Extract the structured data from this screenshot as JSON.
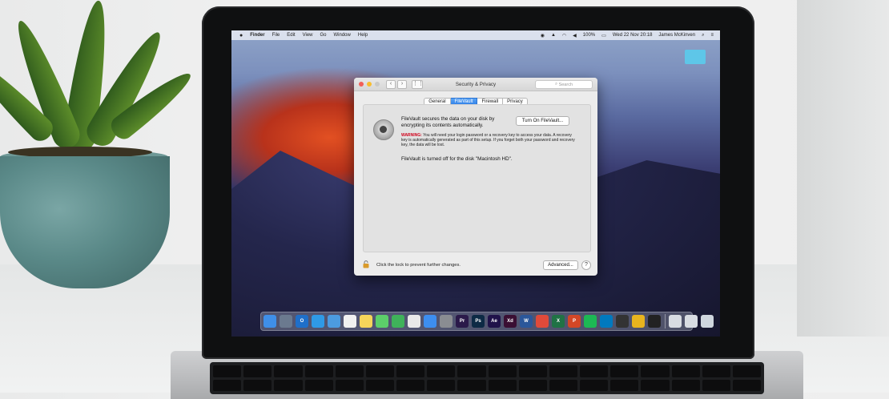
{
  "menubar": {
    "apple": "",
    "items": [
      "Finder",
      "File",
      "Edit",
      "View",
      "Go",
      "Window",
      "Help"
    ],
    "battery": "100%",
    "datetime": "Wed 22 Nov  20:18",
    "user": "James McKinven"
  },
  "window": {
    "title": "Security & Privacy",
    "search_placeholder": "Search",
    "back_glyph": "‹",
    "forward_glyph": "›",
    "tabs": [
      {
        "label": "General",
        "active": false
      },
      {
        "label": "FileVault",
        "active": true
      },
      {
        "label": "Firewall",
        "active": false
      },
      {
        "label": "Privacy",
        "active": false
      }
    ],
    "filevault": {
      "description": "FileVault secures the data on your disk by encrypting its contents automatically.",
      "turn_on_label": "Turn On FileVault...",
      "warning_label": "WARNING:",
      "warning_text": " You will need your login password or a recovery key to access your data. A recovery key is automatically generated as part of this setup. If you forget both your password and recovery key, the data will be lost.",
      "status": "FileVault is turned off for the disk \"Macintosh HD\"."
    },
    "lock_text": "Click the lock to prevent further changes.",
    "advanced_label": "Advanced...",
    "help_label": "?"
  },
  "dock": {
    "apps": [
      {
        "name": "finder-icon",
        "label": "",
        "color": "#3f8fe8"
      },
      {
        "name": "launchpad-icon",
        "label": "",
        "color": "#6b7a8f"
      },
      {
        "name": "outlook-icon",
        "label": "O",
        "color": "#1f6fc9"
      },
      {
        "name": "safari-icon",
        "label": "",
        "color": "#2f9ae6"
      },
      {
        "name": "mail-icon",
        "label": "",
        "color": "#4c9be0"
      },
      {
        "name": "calendar-icon",
        "label": "",
        "color": "#f1f1f1"
      },
      {
        "name": "notes-icon",
        "label": "",
        "color": "#f5d55a"
      },
      {
        "name": "messages-icon",
        "label": "",
        "color": "#5ccf6a"
      },
      {
        "name": "facetime-icon",
        "label": "",
        "color": "#3fb25a"
      },
      {
        "name": "photos-icon",
        "label": "",
        "color": "#e9e9e9"
      },
      {
        "name": "app-store-icon",
        "label": "",
        "color": "#3d8ef0"
      },
      {
        "name": "system-preferences-icon",
        "label": "",
        "color": "#8a8d92"
      },
      {
        "name": "premiere-icon",
        "label": "Pr",
        "color": "#2b1a4a"
      },
      {
        "name": "photoshop-icon",
        "label": "Ps",
        "color": "#0d2a45"
      },
      {
        "name": "after-effects-icon",
        "label": "Ae",
        "color": "#20124a"
      },
      {
        "name": "xd-icon",
        "label": "Xd",
        "color": "#3a0f33"
      },
      {
        "name": "word-icon",
        "label": "W",
        "color": "#2b579a"
      },
      {
        "name": "pdf-icon",
        "label": "",
        "color": "#e04a3a"
      },
      {
        "name": "excel-icon",
        "label": "X",
        "color": "#207245"
      },
      {
        "name": "powerpoint-icon",
        "label": "P",
        "color": "#d24726"
      },
      {
        "name": "spotify-icon",
        "label": "",
        "color": "#1db954"
      },
      {
        "name": "trello-icon",
        "label": "",
        "color": "#0079bf"
      },
      {
        "name": "final-cut-icon",
        "label": "",
        "color": "#333333"
      },
      {
        "name": "chrome-icon",
        "label": "",
        "color": "#e8b41e"
      },
      {
        "name": "terminal-icon",
        "label": "",
        "color": "#222222"
      }
    ],
    "extras": [
      {
        "name": "downloads-stack-icon",
        "color": "#d8dce2"
      },
      {
        "name": "documents-stack-icon",
        "color": "#d8dce2"
      },
      {
        "name": "trash-icon",
        "color": "#cfd6de"
      }
    ]
  }
}
